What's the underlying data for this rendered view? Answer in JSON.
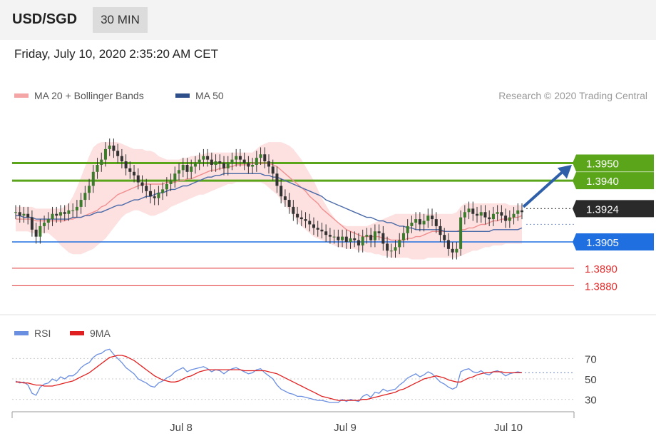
{
  "header": {
    "pair": "USD/SGD",
    "timeframe": "30 MIN"
  },
  "timestamp": "Friday, July 10, 2020 2:35:20 AM CET",
  "legend": [
    {
      "label": "MA 20 + Bollinger Bands",
      "color": "#f4a6a6"
    },
    {
      "label": "MA 50",
      "color": "#2e4f8a"
    }
  ],
  "credit": "Research © 2020 Trading Central",
  "colors": {
    "resistance": "#5aa51a",
    "support": "#1f6fe0",
    "support_red": "#e03030",
    "last": "#222222",
    "arrow": "#2e5fa8",
    "band": "#fde0e0",
    "ma20": "#f09090",
    "ma50": "#4a6aa8",
    "rsi": "#6a8ee0",
    "rsi_ma": "#e02020"
  },
  "chart_data": [
    {
      "type": "candlestick",
      "name": "USD/SGD 30 MIN",
      "x_ticks": [
        "Jul 8",
        "Jul 9",
        "Jul 10"
      ],
      "ylim": [
        1.3872,
        1.3982
      ],
      "levels": [
        {
          "value": 1.395,
          "label": "1.3950",
          "kind": "resistance"
        },
        {
          "value": 1.394,
          "label": "1.3940",
          "kind": "resistance"
        },
        {
          "value": 1.3924,
          "label": "1.3924",
          "kind": "last"
        },
        {
          "value": 1.3905,
          "label": "1.3905",
          "kind": "support"
        },
        {
          "value": 1.389,
          "label": "1.3890",
          "kind": "support_minor"
        },
        {
          "value": 1.388,
          "label": "1.3880",
          "kind": "support_minor"
        }
      ],
      "close": [
        1.3922,
        1.392,
        1.3921,
        1.3919,
        1.3912,
        1.3908,
        1.3914,
        1.3916,
        1.3918,
        1.3921,
        1.392,
        1.3922,
        1.3921,
        1.3923,
        1.3923,
        1.3925,
        1.3929,
        1.3933,
        1.3937,
        1.3945,
        1.3949,
        1.3952,
        1.3958,
        1.396,
        1.3957,
        1.3954,
        1.3951,
        1.3947,
        1.3945,
        1.3943,
        1.3939,
        1.3937,
        1.3934,
        1.3931,
        1.393,
        1.3933,
        1.3935,
        1.3938,
        1.394,
        1.3944,
        1.3946,
        1.3949,
        1.3945,
        1.3948,
        1.395,
        1.3952,
        1.3954,
        1.3952,
        1.3949,
        1.3951,
        1.395,
        1.3947,
        1.395,
        1.3952,
        1.3954,
        1.3952,
        1.395,
        1.3948,
        1.3949,
        1.3953,
        1.3955,
        1.3951,
        1.3948,
        1.3944,
        1.3937,
        1.3931,
        1.3929,
        1.3925,
        1.3921,
        1.3919,
        1.3918,
        1.3917,
        1.3915,
        1.3913,
        1.3912,
        1.3911,
        1.3909,
        1.3908,
        1.3908,
        1.3906,
        1.3908,
        1.3905,
        1.3907,
        1.3906,
        1.3903,
        1.3908,
        1.3909,
        1.3906,
        1.3911,
        1.391,
        1.3904,
        1.39,
        1.39,
        1.3902,
        1.3906,
        1.391,
        1.3914,
        1.3916,
        1.3918,
        1.3915,
        1.3917,
        1.392,
        1.3918,
        1.3914,
        1.3909,
        1.3906,
        1.3901,
        1.3899,
        1.3901,
        1.3919,
        1.3922,
        1.3924,
        1.3921,
        1.392,
        1.3922,
        1.3919,
        1.3918,
        1.3921,
        1.3922,
        1.392,
        1.3917,
        1.3919,
        1.3921,
        1.3923,
        1.3922
      ],
      "ma20": [
        1.3918,
        1.3918,
        1.3918,
        1.3918,
        1.3918,
        1.3917,
        1.3917,
        1.3917,
        1.3917,
        1.3917,
        1.3917,
        1.3917,
        1.3917,
        1.3918,
        1.3918,
        1.3919,
        1.3919,
        1.392,
        1.3921,
        1.3922,
        1.3923,
        1.3925,
        1.3926,
        1.3928,
        1.393,
        1.3932,
        1.3933,
        1.3934,
        1.3935,
        1.3936,
        1.3937,
        1.3938,
        1.3938,
        1.3938,
        1.3938,
        1.3938,
        1.3938,
        1.3939,
        1.3939,
        1.3939,
        1.394,
        1.394,
        1.3941,
        1.3941,
        1.3942,
        1.3943,
        1.3944,
        1.3945,
        1.3946,
        1.3946,
        1.3947,
        1.3947,
        1.3948,
        1.3948,
        1.3949,
        1.3949,
        1.3949,
        1.3949,
        1.395,
        1.395,
        1.395,
        1.395,
        1.395,
        1.3949,
        1.3948,
        1.3946,
        1.3944,
        1.3942,
        1.394,
        1.3938,
        1.3936,
        1.3934,
        1.3931,
        1.3929,
        1.3927,
        1.3924,
        1.3922,
        1.392,
        1.3918,
        1.3916,
        1.3914,
        1.3912,
        1.3911,
        1.391,
        1.3909,
        1.3908,
        1.3908,
        1.3908,
        1.3908,
        1.3908,
        1.3907,
        1.3907,
        1.3906,
        1.3906,
        1.3906,
        1.3906,
        1.3907,
        1.3907,
        1.3908,
        1.3908,
        1.3909,
        1.391,
        1.3911,
        1.3911,
        1.3911,
        1.3911,
        1.3911,
        1.3911,
        1.3911,
        1.3912,
        1.3912,
        1.3913,
        1.3913,
        1.3914,
        1.3915,
        1.3915,
        1.3916,
        1.3917,
        1.3917,
        1.3918,
        1.3918,
        1.3918,
        1.3919,
        1.3919,
        1.392
      ],
      "ma50": [
        1.392,
        1.392,
        1.3919,
        1.3919,
        1.3919,
        1.3918,
        1.3918,
        1.3918,
        1.3918,
        1.3918,
        1.3918,
        1.3918,
        1.3918,
        1.3918,
        1.3919,
        1.3919,
        1.3919,
        1.392,
        1.392,
        1.3921,
        1.3922,
        1.3922,
        1.3923,
        1.3924,
        1.3925,
        1.3926,
        1.3926,
        1.3927,
        1.3928,
        1.3929,
        1.3929,
        1.393,
        1.3931,
        1.3931,
        1.3932,
        1.3933,
        1.3933,
        1.3934,
        1.3935,
        1.3935,
        1.3936,
        1.3937,
        1.3937,
        1.3938,
        1.3939,
        1.394,
        1.3941,
        1.3942,
        1.3942,
        1.3943,
        1.3943,
        1.3944,
        1.3944,
        1.3944,
        1.3944,
        1.3944,
        1.3944,
        1.3944,
        1.3944,
        1.3944,
        1.3944,
        1.3943,
        1.3943,
        1.3942,
        1.3942,
        1.3941,
        1.394,
        1.3939,
        1.3938,
        1.3937,
        1.3936,
        1.3935,
        1.3934,
        1.3933,
        1.3932,
        1.3931,
        1.3929,
        1.3928,
        1.3927,
        1.3926,
        1.3925,
        1.3924,
        1.3923,
        1.3922,
        1.3921,
        1.392,
        1.3919,
        1.3919,
        1.3918,
        1.3917,
        1.3917,
        1.3916,
        1.3916,
        1.3915,
        1.3914,
        1.3914,
        1.3913,
        1.3913,
        1.3912,
        1.3912,
        1.3912,
        1.3912,
        1.3912,
        1.3912,
        1.3912,
        1.3911,
        1.3911,
        1.3911,
        1.3911,
        1.3911,
        1.3911,
        1.3911,
        1.3911,
        1.3911,
        1.3911,
        1.3911,
        1.3911,
        1.3912,
        1.3912,
        1.3912,
        1.3912,
        1.3912,
        1.3912,
        1.3912,
        1.3913
      ],
      "bb_upper": [
        1.3925,
        1.3925,
        1.3925,
        1.3925,
        1.3925,
        1.3924,
        1.3924,
        1.3924,
        1.3924,
        1.3924,
        1.3924,
        1.3924,
        1.3925,
        1.3927,
        1.3931,
        1.3936,
        1.3942,
        1.3948,
        1.3954,
        1.3959,
        1.3961,
        1.3962,
        1.3962,
        1.3962,
        1.3962,
        1.3962,
        1.3961,
        1.396,
        1.3959,
        1.3958,
        1.3958,
        1.3958,
        1.3957,
        1.3957,
        1.3956,
        1.3954,
        1.3953,
        1.3952,
        1.3952,
        1.3952,
        1.3952,
        1.3953,
        1.3953,
        1.3954,
        1.3954,
        1.3955,
        1.3955,
        1.3956,
        1.3956,
        1.3956,
        1.3956,
        1.3956,
        1.3956,
        1.3956,
        1.3956,
        1.3956,
        1.3956,
        1.3956,
        1.3956,
        1.3958,
        1.396,
        1.3961,
        1.3962,
        1.3962,
        1.3962,
        1.3962,
        1.3961,
        1.396,
        1.3958,
        1.3955,
        1.3952,
        1.3948,
        1.3944,
        1.394,
        1.3935,
        1.393,
        1.3926,
        1.3922,
        1.3919,
        1.3916,
        1.3915,
        1.3914,
        1.3914,
        1.3914,
        1.3914,
        1.3914,
        1.3914,
        1.3915,
        1.3916,
        1.3917,
        1.3918,
        1.3919,
        1.392,
        1.3921,
        1.3921,
        1.3921,
        1.3921,
        1.3921,
        1.3921,
        1.3921,
        1.3921,
        1.3921,
        1.3921,
        1.3921,
        1.3921,
        1.3921,
        1.3921,
        1.3921,
        1.3922,
        1.3925,
        1.3927,
        1.3927,
        1.3927,
        1.3927,
        1.3927,
        1.3927,
        1.3927,
        1.3927,
        1.3927,
        1.3927,
        1.3927,
        1.3926,
        1.3926,
        1.3926,
        1.3926
      ],
      "bb_lower": [
        1.3911,
        1.3911,
        1.3911,
        1.3911,
        1.391,
        1.391,
        1.391,
        1.391,
        1.391,
        1.3908,
        1.3906,
        1.3903,
        1.3901,
        1.3899,
        1.3898,
        1.3898,
        1.3898,
        1.3899,
        1.39,
        1.3901,
        1.3903,
        1.3905,
        1.3907,
        1.391,
        1.3913,
        1.3916,
        1.3919,
        1.3921,
        1.3922,
        1.3923,
        1.3923,
        1.3922,
        1.3921,
        1.392,
        1.392,
        1.3921,
        1.3922,
        1.3923,
        1.3925,
        1.3926,
        1.3927,
        1.3928,
        1.3929,
        1.393,
        1.3931,
        1.3932,
        1.3932,
        1.3933,
        1.3934,
        1.3935,
        1.3936,
        1.3937,
        1.3938,
        1.3938,
        1.3939,
        1.3939,
        1.3939,
        1.3939,
        1.3939,
        1.3939,
        1.3939,
        1.3938,
        1.3936,
        1.3934,
        1.3932,
        1.3929,
        1.3926,
        1.3923,
        1.392,
        1.3917,
        1.3914,
        1.3912,
        1.391,
        1.3908,
        1.3907,
        1.3906,
        1.3905,
        1.3904,
        1.3903,
        1.3902,
        1.3902,
        1.3901,
        1.3901,
        1.3901,
        1.39,
        1.39,
        1.3899,
        1.3899,
        1.3898,
        1.3898,
        1.3897,
        1.3897,
        1.3896,
        1.3896,
        1.3896,
        1.3896,
        1.3896,
        1.3895,
        1.3895,
        1.3895,
        1.3895,
        1.3896,
        1.3896,
        1.3896,
        1.3896,
        1.3896,
        1.3896,
        1.3896,
        1.3896,
        1.3897,
        1.3898,
        1.3899,
        1.39,
        1.39,
        1.3901,
        1.3902,
        1.3902,
        1.3903,
        1.3903,
        1.3903,
        1.3904,
        1.3904,
        1.3904,
        1.3904,
        1.3904
      ]
    },
    {
      "type": "line",
      "name": "RSI",
      "yticks": [
        70,
        50,
        30
      ],
      "ylim": [
        20,
        80
      ],
      "series": [
        {
          "name": "RSI",
          "values": [
            48,
            46,
            47,
            44,
            36,
            34,
            42,
            45,
            46,
            50,
            48,
            52,
            50,
            53,
            53,
            56,
            61,
            64,
            66,
            71,
            74,
            75,
            78,
            79,
            74,
            70,
            66,
            61,
            58,
            55,
            50,
            48,
            46,
            43,
            42,
            46,
            48,
            51,
            53,
            57,
            59,
            61,
            57,
            59,
            60,
            61,
            62,
            60,
            57,
            59,
            58,
            55,
            58,
            60,
            61,
            59,
            57,
            55,
            56,
            59,
            60,
            56,
            53,
            50,
            44,
            40,
            38,
            36,
            35,
            33,
            33,
            32,
            31,
            30,
            29,
            29,
            28,
            27,
            27,
            27,
            30,
            28,
            30,
            29,
            28,
            33,
            35,
            32,
            37,
            36,
            40,
            38,
            39,
            40,
            44,
            47,
            51,
            53,
            55,
            52,
            54,
            57,
            55,
            51,
            47,
            45,
            42,
            40,
            42,
            57,
            59,
            60,
            57,
            56,
            58,
            55,
            54,
            57,
            58,
            56,
            53,
            55,
            56,
            57,
            56
          ]
        },
        {
          "name": "9MA",
          "values": [
            47,
            47,
            46,
            46,
            45,
            44,
            44,
            43,
            43,
            43,
            44,
            45,
            46,
            47,
            48,
            50,
            52,
            54,
            56,
            59,
            62,
            65,
            68,
            71,
            72,
            73,
            73,
            72,
            70,
            68,
            65,
            62,
            59,
            56,
            53,
            51,
            49,
            48,
            47,
            47,
            48,
            50,
            52,
            53,
            55,
            57,
            58,
            59,
            59,
            59,
            59,
            59,
            59,
            59,
            59,
            59,
            58,
            58,
            58,
            58,
            58,
            58,
            57,
            56,
            55,
            53,
            51,
            49,
            47,
            45,
            43,
            41,
            39,
            37,
            35,
            33,
            32,
            31,
            30,
            29,
            29,
            29,
            29,
            29,
            29,
            30,
            30,
            31,
            32,
            33,
            34,
            35,
            36,
            37,
            39,
            40,
            42,
            44,
            46,
            48,
            50,
            51,
            52,
            53,
            52,
            51,
            49,
            48,
            47,
            47,
            49,
            51,
            52,
            54,
            55,
            56,
            56,
            57,
            57,
            57,
            56,
            56,
            56,
            56,
            56
          ]
        }
      ]
    }
  ]
}
